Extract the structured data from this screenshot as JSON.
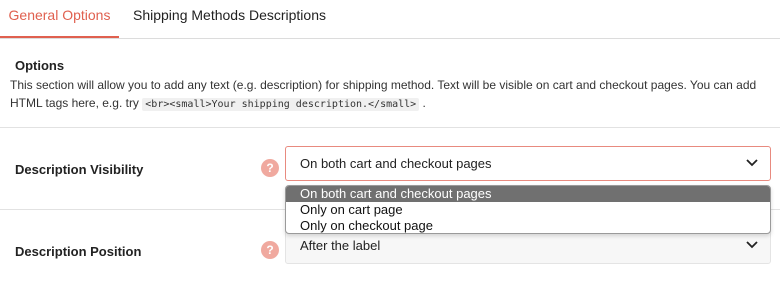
{
  "tabs": [
    {
      "label": "General Options",
      "active": true
    },
    {
      "label": "Shipping Methods Descriptions",
      "active": false
    }
  ],
  "options": {
    "title": "Options",
    "description_before": "This section will allow you to add any text (e.g. description) for shipping method. Text will be visible on cart and checkout pages. You can add HTML tags here, e.g. try ",
    "code_example": "<br><small>Your shipping description.</small>",
    "description_after": " ."
  },
  "visibility": {
    "label": "Description Visibility",
    "help_glyph": "?",
    "selected": "On both cart and checkout pages",
    "options": [
      "On both cart and checkout pages",
      "Only on cart page",
      "Only on checkout page"
    ]
  },
  "position": {
    "label": "Description Position",
    "help_glyph": "?",
    "selected": "After the label"
  },
  "colors": {
    "accent": "#e0604f",
    "help_icon": "#f0a99f",
    "dropdown_highlight": "#707070"
  }
}
